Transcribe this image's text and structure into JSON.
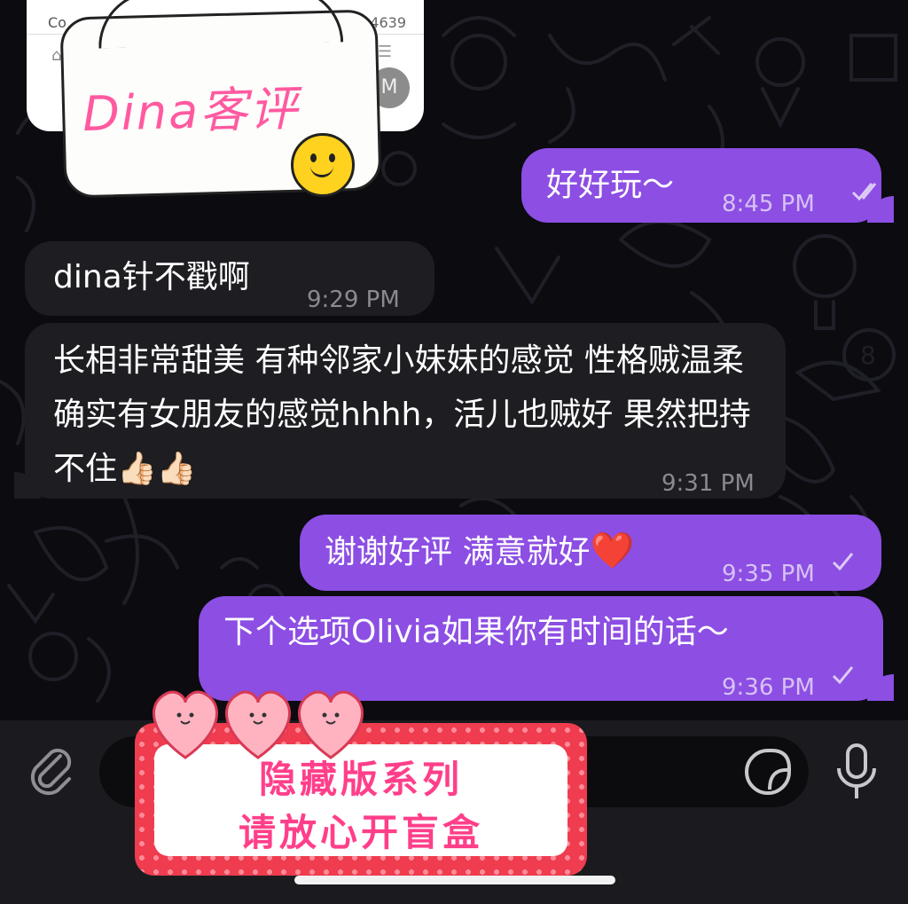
{
  "quoted_message": {
    "prefix_text": "Co",
    "count_text": "4639",
    "home_text": "H",
    "avatar_letter": "M"
  },
  "sticker_top": {
    "text": "Dina客评"
  },
  "messages": [
    {
      "id": "m1",
      "direction": "outgoing",
      "text": "好好玩～",
      "time": "8:45 PM",
      "status": "read"
    },
    {
      "id": "m2",
      "direction": "incoming",
      "text": "dina针不戳啊",
      "time": "9:29 PM"
    },
    {
      "id": "m3",
      "direction": "incoming",
      "text": "长相非常甜美 有种邻家小妹妹的感觉 性格贼温柔 确实有女朋友的感觉hhhh，活儿也贼好 果然把持不住",
      "time": "9:31 PM",
      "emoji_suffix": "👍🏻👍🏻"
    },
    {
      "id": "m4",
      "direction": "outgoing",
      "text": "谢谢好评 满意就好",
      "time": "9:35 PM",
      "status": "sent",
      "emoji_suffix": "❤️"
    },
    {
      "id": "m5",
      "direction": "outgoing",
      "text": "下个选项Olivia如果你有时间的话～",
      "time": "9:36 PM",
      "status": "sent"
    }
  ],
  "sticker_bottom": {
    "line1": "隐藏版系列",
    "line2": "请放心开盲盒"
  },
  "input_bar": {
    "attach_icon": "paperclip-icon",
    "sticker_icon": "sticker-icon",
    "mic_icon": "microphone-icon"
  },
  "colors": {
    "outgoing_bubble": "#8c4ee3",
    "incoming_bubble": "#1d1d22",
    "background": "#0b0b10",
    "sticker_pink": "#ff5aa0",
    "box_red": "#ef3c4f"
  }
}
